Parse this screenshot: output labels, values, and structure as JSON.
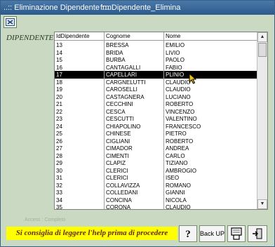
{
  "window": {
    "title": "..:: Eliminazione Dipendente ::..",
    "form_name": "frmDipendente_Elimina"
  },
  "section_label": "DIPENDENTE",
  "list": {
    "headers": [
      "IdDipendente",
      "Cognome",
      "Nome"
    ],
    "selected_id": "17",
    "rows": [
      [
        "13",
        "BRESSA",
        "EMILIO"
      ],
      [
        "14",
        "BRIDA",
        "LIVIO"
      ],
      [
        "15",
        "BURBA",
        "PAOLO"
      ],
      [
        "16",
        "CANTAGALLI",
        "FABIO"
      ],
      [
        "17",
        "CAPELLARI",
        "PLINIO"
      ],
      [
        "18",
        "CARGNELUTTI",
        "CLAUDIO"
      ],
      [
        "19",
        "CAROSELLI",
        "CLAUDIO"
      ],
      [
        "20",
        "CASTAGNERA",
        "LUCIANO"
      ],
      [
        "21",
        "CECCHINI",
        "ROBERTO"
      ],
      [
        "22",
        "CESCA",
        "VINCENZO"
      ],
      [
        "23",
        "CESCUTTI",
        "VALENTINO"
      ],
      [
        "24",
        "CHIAPOLINO",
        "FRANCESCO"
      ],
      [
        "25",
        "CHINESE",
        "PIETRO"
      ],
      [
        "26",
        "CIGLIANI",
        "ROBERTO"
      ],
      [
        "27",
        "CIMADOR",
        "ANDREA"
      ],
      [
        "28",
        "CIMENTI",
        "CARLO"
      ],
      [
        "29",
        "CLAPIZ",
        "TIZIANO"
      ],
      [
        "30",
        "CLERICI",
        "AMBROGIO"
      ],
      [
        "31",
        "CLERICI",
        "ISEO"
      ],
      [
        "32",
        "COLLAVIZZA",
        "ROMANO"
      ],
      [
        "33",
        "COLLEDANI",
        "GIANNI"
      ],
      [
        "34",
        "CONCINA",
        "NICOLA"
      ],
      [
        "35",
        "CORONA",
        "CLAUDIO"
      ]
    ]
  },
  "footnote": "Access : Completo",
  "notice": "Si consiglia di leggere l'help prima di procedere",
  "buttons": {
    "help_icon": "question-mark-icon",
    "backup_label": "Back UP",
    "delete_icon": "delete-record-icon",
    "exit_icon": "exit-door-icon"
  },
  "colors": {
    "window_bg": "#c9d9c2",
    "title_bar": "#2c5a8c",
    "notice_bg": "#ffff00",
    "notice_text": "#6a2a00",
    "selection_bg": "#000000"
  }
}
